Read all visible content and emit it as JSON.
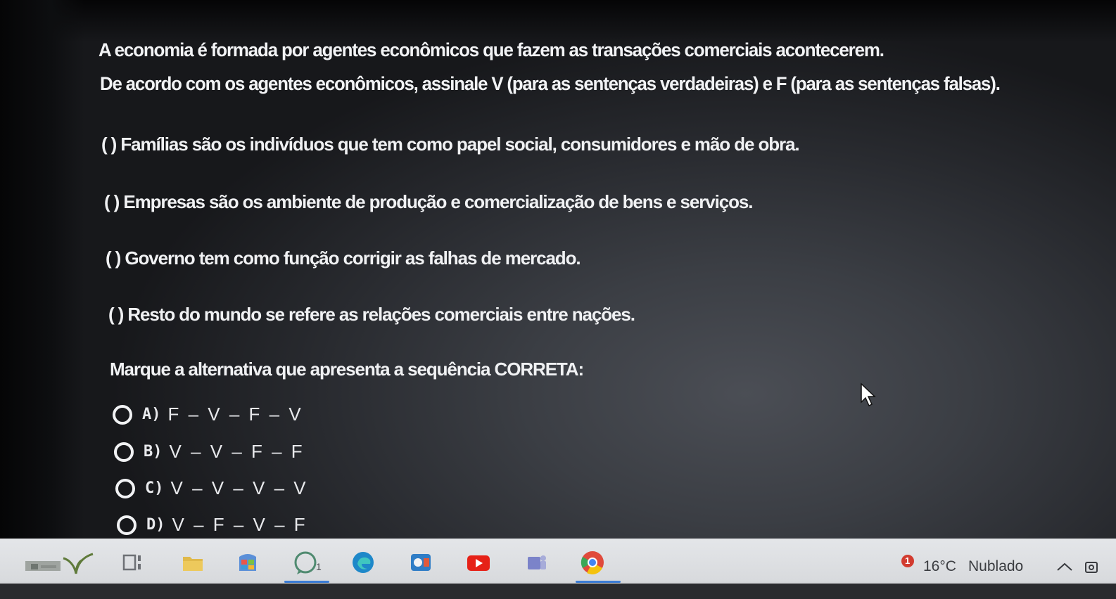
{
  "question": {
    "line1": "A economia é formada por agentes econômicos que fazem as transações comerciais acontecerem.",
    "line2": "De acordo com os agentes econômicos, assinale V (para as sentenças verdadeiras) e F (para as sentenças falsas)."
  },
  "statements": [
    "( ) Famílias são os indivíduos que tem como papel social, consumidores e mão de obra.",
    "( ) Empresas são os ambiente de produção e comercialização de bens e serviços.",
    "( ) Governo tem como função corrigir as falhas de mercado.",
    "( ) Resto do mundo se refere as relações comerciais entre nações."
  ],
  "prompt": "Marque a alternativa que apresenta a sequência CORRETA:",
  "options": [
    {
      "letter": "A)",
      "sequence": "F – V – F – V"
    },
    {
      "letter": "B)",
      "sequence": "V – V – F – F"
    },
    {
      "letter": "C)",
      "sequence": "V – V – V – V"
    },
    {
      "letter": "D)",
      "sequence": "V – F – V – F"
    }
  ],
  "taskbar": {
    "badge_count": "1",
    "notification_badge": "1",
    "temperature": "16°C",
    "weather": "Nublado"
  },
  "colors": {
    "text": "#f2f3f5",
    "taskbar": "#dfe1e4",
    "accent": "#3a7bd5"
  }
}
